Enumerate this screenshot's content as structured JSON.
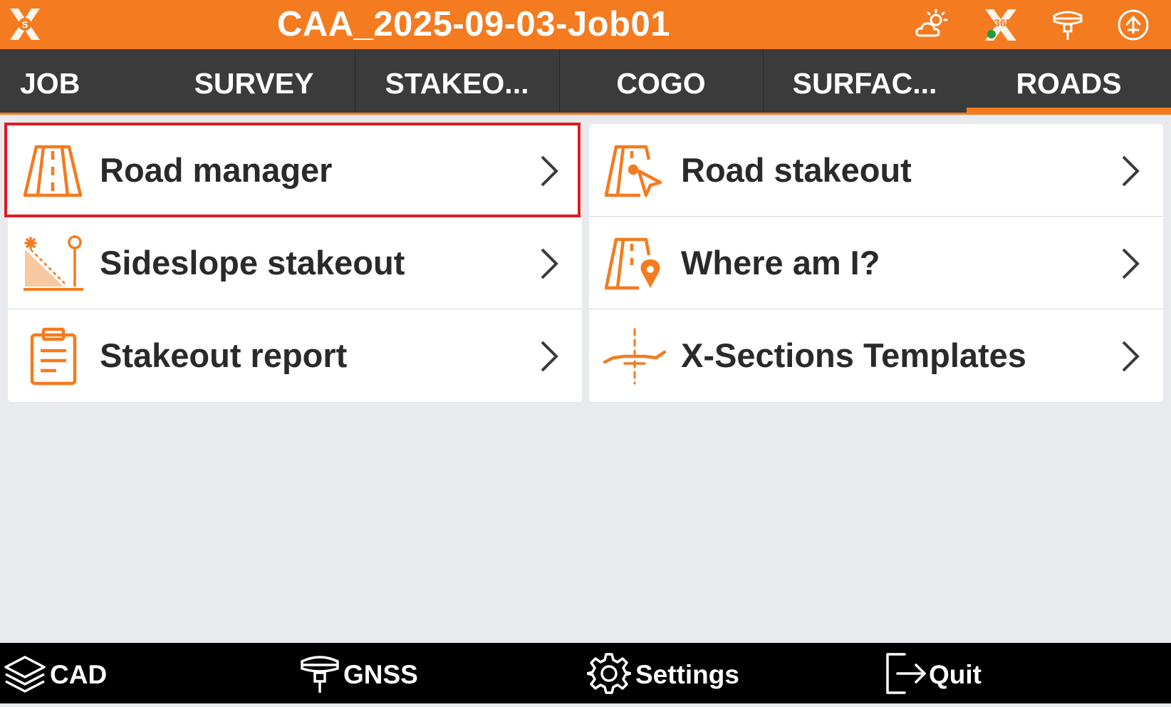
{
  "header": {
    "title": "CAA_2025-09-03-Job01",
    "logo_letter": "S",
    "status_badge_text": "365",
    "icons": [
      "app-logo-icon",
      "weather-icon",
      "x365-status-icon",
      "gnss-receiver-icon",
      "upload-icon"
    ]
  },
  "tabs": [
    {
      "label": "JOB",
      "selected": false
    },
    {
      "label": "SURVEY",
      "selected": false
    },
    {
      "label": "STAKEO...",
      "selected": false
    },
    {
      "label": "COGO",
      "selected": false
    },
    {
      "label": "SURFAC...",
      "selected": false
    },
    {
      "label": "ROADS",
      "selected": true
    }
  ],
  "menu": {
    "left": [
      {
        "label": "Road manager",
        "icon": "road-icon"
      },
      {
        "label": "Sideslope stakeout",
        "icon": "sideslope-icon"
      },
      {
        "label": "Stakeout report",
        "icon": "clipboard-icon"
      }
    ],
    "right": [
      {
        "label": "Road stakeout",
        "icon": "road-stakeout-icon"
      },
      {
        "label": "Where am I?",
        "icon": "road-location-icon"
      },
      {
        "label": "X-Sections Templates",
        "icon": "cross-section-icon"
      }
    ],
    "highlighted_item": "Road manager"
  },
  "bottom_bar": {
    "cad": "CAD",
    "gnss": "GNSS",
    "settings": "Settings",
    "quit": "Quit"
  },
  "colors": {
    "accent": "#f47b20",
    "tab_bar": "#3b3b3b",
    "background": "#e9eaee",
    "highlight": "#e01b24",
    "bottom_bar": "#000000",
    "status_dot": "#1e9e3a"
  }
}
